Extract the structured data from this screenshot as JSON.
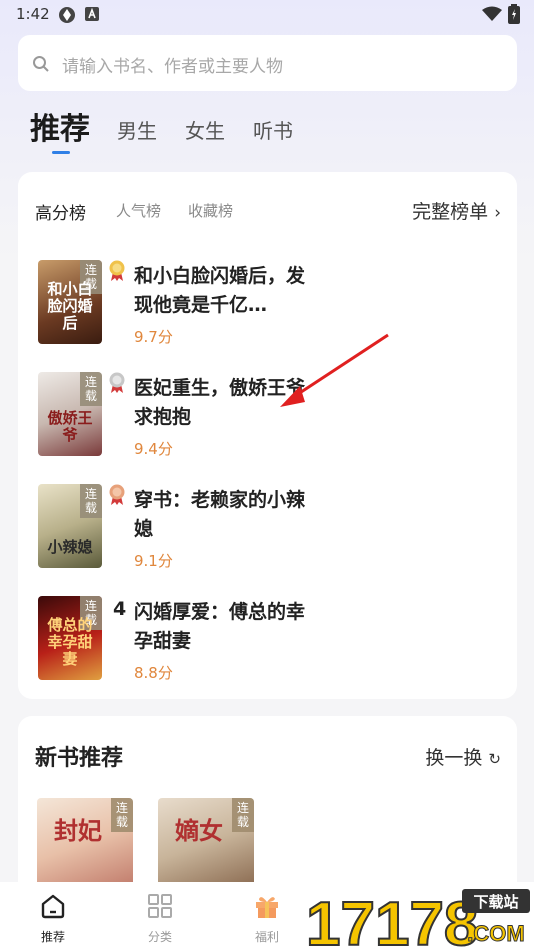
{
  "status_bar": {
    "time": "1:42"
  },
  "search": {
    "placeholder": "请输入书名、作者或主要人物"
  },
  "top_tabs": [
    {
      "label": "推荐",
      "active": true
    },
    {
      "label": "男生"
    },
    {
      "label": "女生"
    },
    {
      "label": "听书"
    }
  ],
  "ranking": {
    "tabs": [
      {
        "label": "高分榜",
        "active": true
      },
      {
        "label": "人气榜"
      },
      {
        "label": "收藏榜"
      }
    ],
    "more_label": "完整榜单",
    "books": [
      {
        "rank": "1",
        "title": "和小白脸闪婚后，发现他竟是千亿…",
        "score": "9.7分",
        "tag": "连载",
        "cover_text": "和小白脸闪婚后"
      },
      {
        "rank": "2",
        "title": "医妃重生，傲娇王爷求抱抱",
        "score": "9.4分",
        "tag": "连载",
        "cover_text": "傲娇王爷"
      },
      {
        "rank": "3",
        "title": "穿书：老赖家的小辣媳",
        "score": "9.1分",
        "tag": "连载",
        "cover_text": "小辣媳"
      },
      {
        "rank": "4",
        "title": "闪婚厚爱：傅总的幸孕甜妻",
        "score": "8.8分",
        "tag": "连载",
        "cover_text": "傅总的幸孕甜妻"
      }
    ]
  },
  "new_books": {
    "title": "新书推荐",
    "refresh_label": "换一换",
    "books": [
      {
        "tag": "连载",
        "cover_text": "封妃"
      },
      {
        "tag": "连载",
        "cover_text": "嫡女"
      }
    ]
  },
  "bottom_nav": [
    {
      "label": "推荐",
      "icon": "home-icon",
      "active": true
    },
    {
      "label": "分类",
      "icon": "grid-icon"
    },
    {
      "label": "福利",
      "icon": "gift-icon"
    }
  ],
  "watermark": {
    "label": "下载站",
    "brand": "17178",
    "suffix": ".COM"
  },
  "colors": {
    "accent": "#2f7fe6",
    "score": "#e0873d",
    "arrow": "#e02020"
  }
}
